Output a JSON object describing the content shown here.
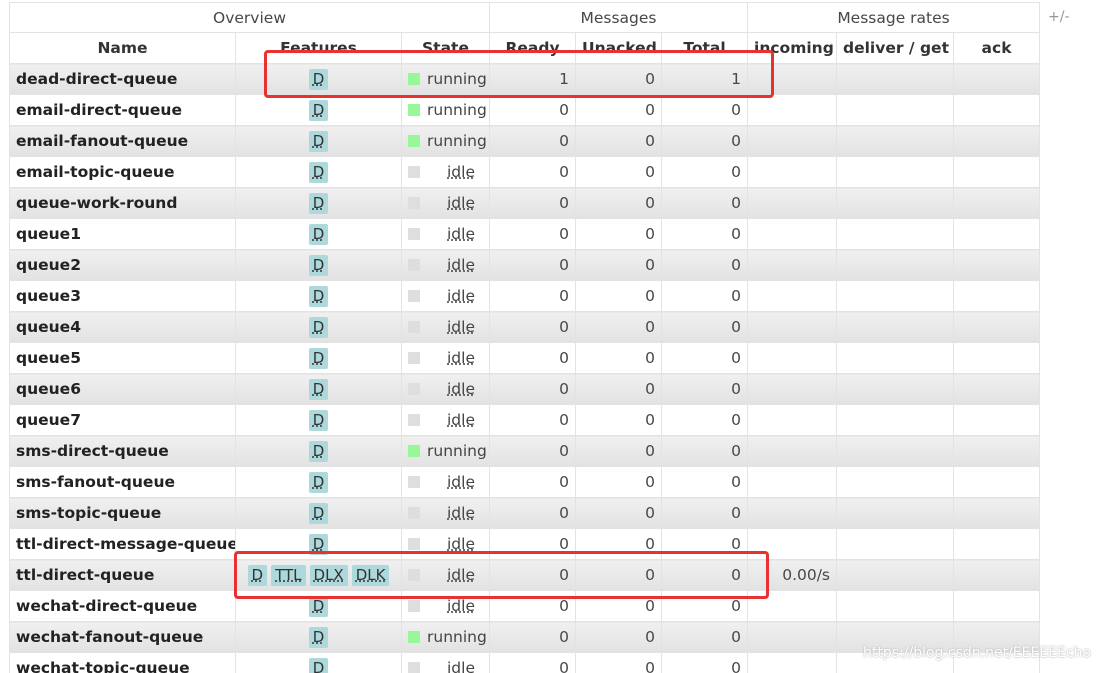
{
  "headers": {
    "groups": [
      "Overview",
      "Messages",
      "Message rates"
    ],
    "toggle": "+/-",
    "columns": [
      "Name",
      "Features",
      "State",
      "Ready",
      "Unacked",
      "Total",
      "incoming",
      "deliver / get",
      "ack"
    ]
  },
  "colors": {
    "running": "#98f898",
    "idle": "#dedede",
    "feature_tag": "#add8dc",
    "highlight": "#e8322f"
  },
  "rows": [
    {
      "name": "dead-direct-queue",
      "features": [
        "D"
      ],
      "state": "running",
      "ready": "1",
      "unacked": "0",
      "total": "1",
      "incoming": "",
      "deliver": "",
      "ack": ""
    },
    {
      "name": "email-direct-queue",
      "features": [
        "D"
      ],
      "state": "running",
      "ready": "0",
      "unacked": "0",
      "total": "0",
      "incoming": "",
      "deliver": "",
      "ack": ""
    },
    {
      "name": "email-fanout-queue",
      "features": [
        "D"
      ],
      "state": "running",
      "ready": "0",
      "unacked": "0",
      "total": "0",
      "incoming": "",
      "deliver": "",
      "ack": ""
    },
    {
      "name": "email-topic-queue",
      "features": [
        "D"
      ],
      "state": "idle",
      "ready": "0",
      "unacked": "0",
      "total": "0",
      "incoming": "",
      "deliver": "",
      "ack": ""
    },
    {
      "name": "queue-work-round",
      "features": [
        "D"
      ],
      "state": "idle",
      "ready": "0",
      "unacked": "0",
      "total": "0",
      "incoming": "",
      "deliver": "",
      "ack": ""
    },
    {
      "name": "queue1",
      "features": [
        "D"
      ],
      "state": "idle",
      "ready": "0",
      "unacked": "0",
      "total": "0",
      "incoming": "",
      "deliver": "",
      "ack": ""
    },
    {
      "name": "queue2",
      "features": [
        "D"
      ],
      "state": "idle",
      "ready": "0",
      "unacked": "0",
      "total": "0",
      "incoming": "",
      "deliver": "",
      "ack": ""
    },
    {
      "name": "queue3",
      "features": [
        "D"
      ],
      "state": "idle",
      "ready": "0",
      "unacked": "0",
      "total": "0",
      "incoming": "",
      "deliver": "",
      "ack": ""
    },
    {
      "name": "queue4",
      "features": [
        "D"
      ],
      "state": "idle",
      "ready": "0",
      "unacked": "0",
      "total": "0",
      "incoming": "",
      "deliver": "",
      "ack": ""
    },
    {
      "name": "queue5",
      "features": [
        "D"
      ],
      "state": "idle",
      "ready": "0",
      "unacked": "0",
      "total": "0",
      "incoming": "",
      "deliver": "",
      "ack": ""
    },
    {
      "name": "queue6",
      "features": [
        "D"
      ],
      "state": "idle",
      "ready": "0",
      "unacked": "0",
      "total": "0",
      "incoming": "",
      "deliver": "",
      "ack": ""
    },
    {
      "name": "queue7",
      "features": [
        "D"
      ],
      "state": "idle",
      "ready": "0",
      "unacked": "0",
      "total": "0",
      "incoming": "",
      "deliver": "",
      "ack": ""
    },
    {
      "name": "sms-direct-queue",
      "features": [
        "D"
      ],
      "state": "running",
      "ready": "0",
      "unacked": "0",
      "total": "0",
      "incoming": "",
      "deliver": "",
      "ack": ""
    },
    {
      "name": "sms-fanout-queue",
      "features": [
        "D"
      ],
      "state": "idle",
      "ready": "0",
      "unacked": "0",
      "total": "0",
      "incoming": "",
      "deliver": "",
      "ack": ""
    },
    {
      "name": "sms-topic-queue",
      "features": [
        "D"
      ],
      "state": "idle",
      "ready": "0",
      "unacked": "0",
      "total": "0",
      "incoming": "",
      "deliver": "",
      "ack": ""
    },
    {
      "name": "ttl-direct-message-queue",
      "features": [
        "D"
      ],
      "state": "idle",
      "ready": "0",
      "unacked": "0",
      "total": "0",
      "incoming": "",
      "deliver": "",
      "ack": ""
    },
    {
      "name": "ttl-direct-queue",
      "features": [
        "D",
        "TTL",
        "DLX",
        "DLK"
      ],
      "state": "idle",
      "ready": "0",
      "unacked": "0",
      "total": "0",
      "incoming": "0.00/s",
      "deliver": "",
      "ack": ""
    },
    {
      "name": "wechat-direct-queue",
      "features": [
        "D"
      ],
      "state": "idle",
      "ready": "0",
      "unacked": "0",
      "total": "0",
      "incoming": "",
      "deliver": "",
      "ack": ""
    },
    {
      "name": "wechat-fanout-queue",
      "features": [
        "D"
      ],
      "state": "running",
      "ready": "0",
      "unacked": "0",
      "total": "0",
      "incoming": "",
      "deliver": "",
      "ack": ""
    },
    {
      "name": "wechat-topic-queue",
      "features": [
        "D"
      ],
      "state": "idle",
      "ready": "0",
      "unacked": "0",
      "total": "0",
      "incoming": "",
      "deliver": "",
      "ack": ""
    }
  ],
  "watermark": "https://blog.csdn.net/EEEEEEcho"
}
